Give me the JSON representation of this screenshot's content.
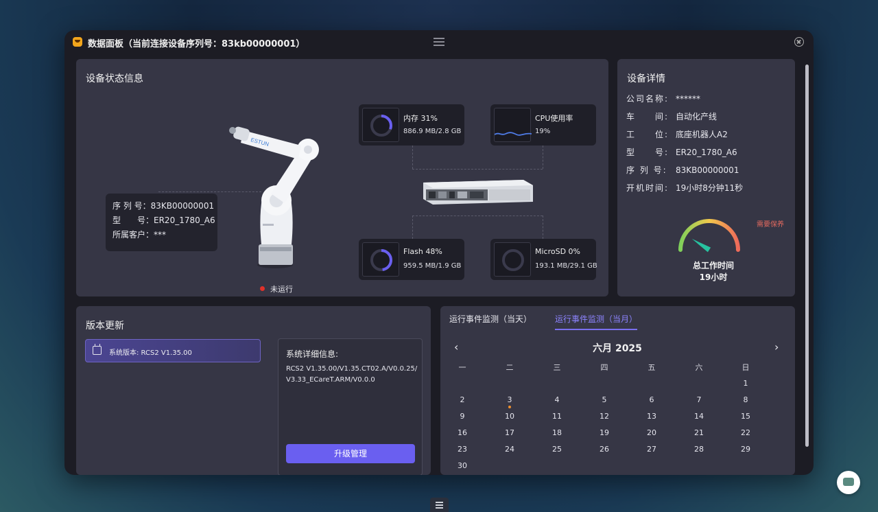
{
  "window": {
    "title": "数据面板（当前连接设备序列号：83kb00000001）"
  },
  "status_panel": {
    "title": "设备状态信息",
    "robot_brand": "ESTUN",
    "info": [
      {
        "label": "序 列 号：",
        "value": "83KB00000001"
      },
      {
        "label": "型　　号：",
        "value": "ER20_1780_A6"
      },
      {
        "label": "所属客户：",
        "value": "***"
      }
    ],
    "metrics": {
      "memory": {
        "label": "内存 31%",
        "detail": "886.9 MB/2.8 GB",
        "percent": 31
      },
      "cpu": {
        "label": "CPU使用率",
        "detail": "19%",
        "percent": 19
      },
      "flash": {
        "label": "Flash 48%",
        "detail": "959.5 MB/1.9 GB",
        "percent": 48
      },
      "microsd": {
        "label": "MicroSD 0%",
        "detail": "193.1 MB/29.1 GB",
        "percent": 0
      }
    },
    "run_status": "未运行",
    "colors": {
      "ring": "#6a5ff0",
      "ring_track": "#3a3a4c",
      "cpu_line": "#4f7ce8",
      "stopped": "#e0312a"
    }
  },
  "details_panel": {
    "title": "设备详情",
    "rows": [
      {
        "key": "公司名称:",
        "value": "******"
      },
      {
        "key": "车　　间:",
        "value": "自动化产线"
      },
      {
        "key": "工　　位:",
        "value": "底座机器人A2"
      },
      {
        "key": "型　　号:",
        "value": "ER20_1780_A6"
      },
      {
        "key": "序 列 号:",
        "value": "83KB00000001"
      },
      {
        "key": "开机时间:",
        "value": "19小时8分钟11秒"
      }
    ],
    "maintenance_label": "需要保养",
    "total_work_label": "总工作时间",
    "total_work_value": "19小时",
    "gauge_fraction": 0.18
  },
  "version_panel": {
    "title": "版本更新",
    "system_version": "系统版本: RCS2 V1.35.00",
    "detail_title": "系统详细信息:",
    "detail_text": "RCS2 V1.35.00/V1.35.CT02.A/V0.0.25/V3.33_ECareT.ARM/V0.0.0",
    "upgrade_label": "升级管理"
  },
  "events_panel": {
    "tabs": [
      "运行事件监测（当天）",
      "运行事件监测（当月）"
    ],
    "active_tab": 1,
    "month_label": "六月 2025",
    "prev_icon": "‹",
    "next_icon": "›",
    "weekdays": [
      "一",
      "二",
      "三",
      "四",
      "五",
      "六",
      "日"
    ],
    "first_weekday_index": 6,
    "days_in_month": 30,
    "event_days": [
      3
    ]
  }
}
